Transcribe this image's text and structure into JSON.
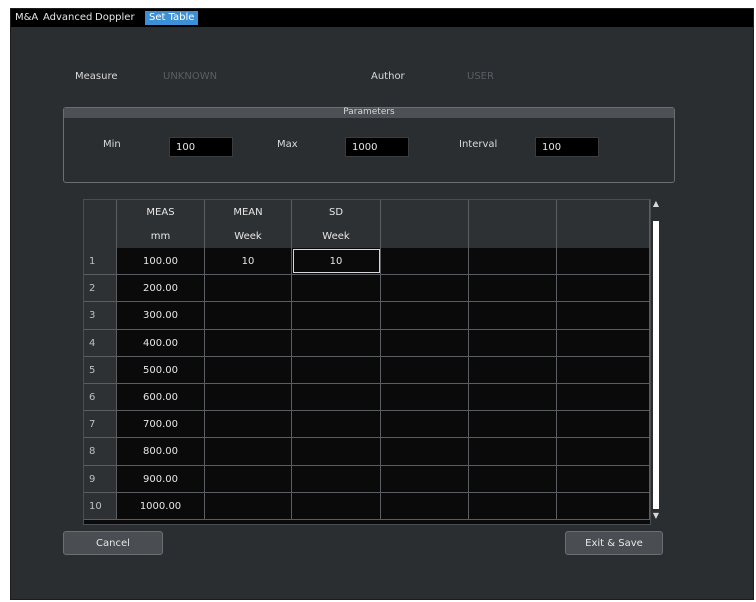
{
  "titlebar": {
    "crumbs": [
      "M&A",
      "Advanced",
      "Doppler",
      "Set Table"
    ]
  },
  "meta": {
    "measure_label": "Measure",
    "measure_value": "UNKNOWN",
    "author_label": "Author",
    "author_value": "USER"
  },
  "parameters": {
    "legend": "Parameters",
    "min_label": "Min",
    "min_value": "100",
    "max_label": "Max",
    "max_value": "1000",
    "interval_label": "Interval",
    "interval_value": "100"
  },
  "table": {
    "columns": [
      {
        "name": "MEAS",
        "unit": "mm"
      },
      {
        "name": "MEAN",
        "unit": "Week"
      },
      {
        "name": "SD",
        "unit": "Week"
      },
      {
        "name": "",
        "unit": ""
      },
      {
        "name": "",
        "unit": ""
      },
      {
        "name": "",
        "unit": ""
      }
    ],
    "rows": [
      {
        "index": "1",
        "cells": [
          "100.00",
          "10",
          "10",
          "",
          "",
          ""
        ]
      },
      {
        "index": "2",
        "cells": [
          "200.00",
          "",
          "",
          "",
          "",
          ""
        ]
      },
      {
        "index": "3",
        "cells": [
          "300.00",
          "",
          "",
          "",
          "",
          ""
        ]
      },
      {
        "index": "4",
        "cells": [
          "400.00",
          "",
          "",
          "",
          "",
          ""
        ]
      },
      {
        "index": "5",
        "cells": [
          "500.00",
          "",
          "",
          "",
          "",
          ""
        ]
      },
      {
        "index": "6",
        "cells": [
          "600.00",
          "",
          "",
          "",
          "",
          ""
        ]
      },
      {
        "index": "7",
        "cells": [
          "700.00",
          "",
          "",
          "",
          "",
          ""
        ]
      },
      {
        "index": "8",
        "cells": [
          "800.00",
          "",
          "",
          "",
          "",
          ""
        ]
      },
      {
        "index": "9",
        "cells": [
          "900.00",
          "",
          "",
          "",
          "",
          ""
        ]
      },
      {
        "index": "10",
        "cells": [
          "1000.00",
          "",
          "",
          "",
          "",
          ""
        ]
      }
    ],
    "selected": {
      "row": 0,
      "col": 2
    }
  },
  "buttons": {
    "cancel": "Cancel",
    "exit_save": "Exit & Save"
  },
  "colors": {
    "window_bg": "#2b2e31",
    "titlebar_bg": "#000000",
    "active_crumb": "#3d8fd6",
    "cell_bg": "#000000",
    "header_bg": "#2e3134"
  }
}
